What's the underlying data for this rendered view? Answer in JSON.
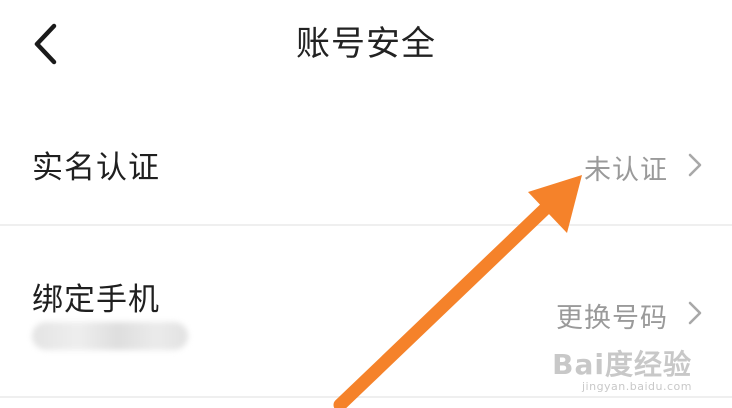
{
  "header": {
    "title": "账号安全",
    "back_icon": "chevron-left-icon"
  },
  "rows": [
    {
      "label": "实名认证",
      "value": "未认证",
      "icon": "chevron-right-icon"
    },
    {
      "label": "绑定手机",
      "value": "更换号码",
      "icon": "chevron-right-icon",
      "masked_value": "blurred phone number"
    }
  ],
  "watermark": {
    "logo": "Bai度经验",
    "url": "jingyan.baidu.com"
  },
  "colors": {
    "title_text": "#222222",
    "label_text": "#1f1f1f",
    "value_text": "#9a9a9a",
    "divider": "#efefef",
    "annotation_arrow": "#f5822a"
  }
}
